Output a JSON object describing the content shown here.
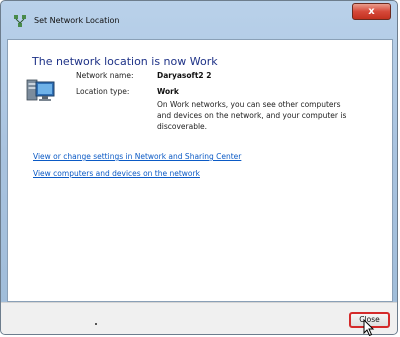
{
  "window": {
    "title": "Set Network Location",
    "close_glyph": "x"
  },
  "main": {
    "heading": "The network location is now Work",
    "network_name_label": "Network name:",
    "network_name_value": "Daryasoft2 2",
    "location_type_label": "Location type:",
    "location_type_value": "Work",
    "description": "On Work networks, you can see other computers and devices on the network, and your computer is discoverable.",
    "links": [
      "View or change settings in Network and Sharing Center",
      "View computers and devices on the network"
    ]
  },
  "footer": {
    "close_label": "Close"
  },
  "icons": {
    "title": "network-icon",
    "location": "work-network-monitor-icon",
    "cursor": "mouse-pointer-icon"
  },
  "colors": {
    "heading": "#1e3287",
    "link": "#0b5ac5",
    "close_button_highlight": "#d42a2a",
    "titlebar_close": "#d6493a"
  }
}
